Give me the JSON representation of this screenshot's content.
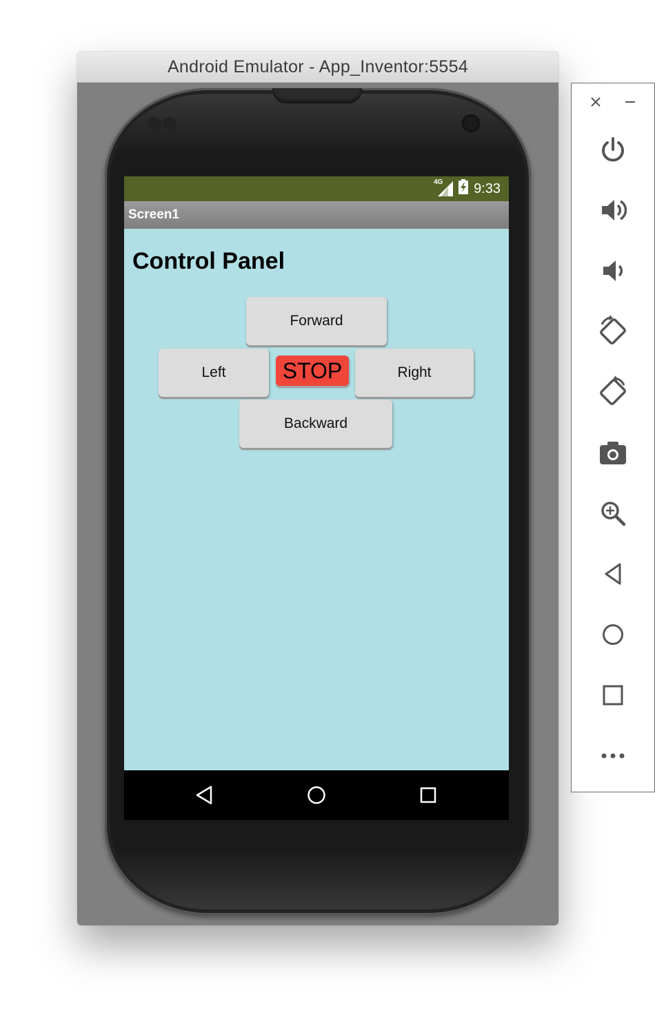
{
  "window": {
    "title": "Android Emulator - App_Inventor:5554"
  },
  "status_bar": {
    "network": "4G",
    "time": "9:33"
  },
  "app_bar": {
    "title": "Screen1"
  },
  "screen": {
    "heading": "Control Panel",
    "buttons": {
      "forward": "Forward",
      "left": "Left",
      "stop": "STOP",
      "right": "Right",
      "backward": "Backward"
    }
  },
  "colors": {
    "status_bar": "#556426",
    "content_bg": "#b0dfe5",
    "stop_button": "#f0463a"
  },
  "nav_bar": {
    "icons": [
      "back-icon",
      "home-icon",
      "recents-icon"
    ]
  },
  "toolbar": {
    "window_controls": [
      "close-icon",
      "minimize-icon"
    ],
    "tools": [
      "power-icon",
      "volume-up-icon",
      "volume-down-icon",
      "rotate-left-icon",
      "rotate-right-icon",
      "camera-icon",
      "zoom-icon",
      "back-icon",
      "home-icon",
      "overview-icon",
      "more-icon"
    ]
  }
}
